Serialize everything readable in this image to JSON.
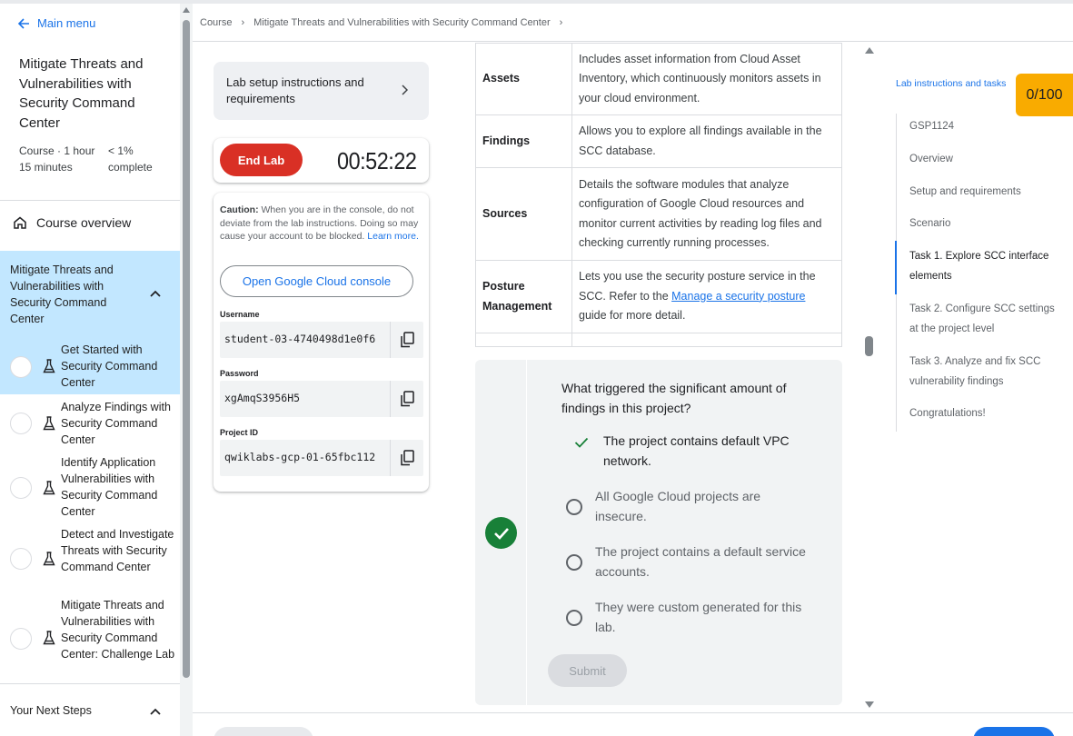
{
  "sidebar": {
    "main_menu": "Main menu",
    "course_title": "Mitigate Threats and Vulnerabilities with Security Command Center",
    "course_meta": "Course · 1 hour 15 minutes",
    "progress": "< 1% complete",
    "course_overview": "Course overview",
    "section_title": "Mitigate Threats and Vulnerabilities with Security Command Center",
    "labs": [
      {
        "label": "Get Started with Security Command Center",
        "active": true
      },
      {
        "label": "Analyze Findings with Security Command Center",
        "active": false
      },
      {
        "label": "Identify Application Vulnerabilities with Security Command Center",
        "active": false
      },
      {
        "label": "Detect and Investigate Threats with Security Command Center",
        "active": false
      },
      {
        "label": "Mitigate Threats and Vulnerabilities with Security Command Center: Challenge Lab",
        "active": false
      }
    ],
    "next_steps": "Your Next Steps"
  },
  "breadcrumb": {
    "course": "Course",
    "title": "Mitigate Threats and Vulnerabilities with Security Command Center"
  },
  "lab_panel": {
    "setup_label": "Lab setup instructions and requirements",
    "end_lab": "End Lab",
    "timer": "00:52:22",
    "caution_bold": "Caution:",
    "caution_text": " When you are in the console, do not deviate from the lab instructions. Doing so may cause your account to be blocked.",
    "learn_more": "Learn more.",
    "open_console": "Open Google Cloud console",
    "username_label": "Username",
    "username": "student-03-4740498d1e0f6",
    "password_label": "Password",
    "password": "xgAmqS3956H5",
    "project_label": "Project ID",
    "project_id": "qwiklabs-gcp-01-65fbc112"
  },
  "feature_table": {
    "rows": [
      {
        "key": "Assets",
        "value": "Includes asset information from Cloud Asset Inventory, which continuously monitors assets in your cloud environment."
      },
      {
        "key": "Findings",
        "value": "Allows you to explore all findings available in the SCC database."
      },
      {
        "key": "Sources",
        "value": "Details the software modules that analyze configuration of Google Cloud resources and monitor current activities by reading log files and checking currently running processes."
      },
      {
        "key": "Posture Management",
        "value_pre": "Lets you use the security posture service in the SCC. Refer to the ",
        "value_link": "Manage a security posture",
        "value_post": " guide for more detail."
      }
    ]
  },
  "quiz": {
    "question": "What triggered the significant amount of findings in this project?",
    "options": [
      {
        "label": "The project contains default VPC network.",
        "correct": true
      },
      {
        "label": "All Google Cloud projects are insecure.",
        "correct": false
      },
      {
        "label": "The project contains a default service accounts.",
        "correct": false
      },
      {
        "label": "They were custom generated for this lab.",
        "correct": false
      }
    ],
    "submit": "Submit"
  },
  "toc": {
    "title": "Lab instructions and tasks",
    "score": "0/100",
    "items": [
      {
        "label": "GSP1124",
        "active": false
      },
      {
        "label": "Overview",
        "active": false
      },
      {
        "label": "Setup and requirements",
        "active": false
      },
      {
        "label": "Scenario",
        "active": false
      },
      {
        "label": "Task 1. Explore SCC interface elements",
        "active": true
      },
      {
        "label": "Task 2. Configure SCC settings at the project level",
        "active": false
      },
      {
        "label": "Task 3. Analyze and fix SCC vulnerability findings",
        "active": false
      },
      {
        "label": "Congratulations!",
        "active": false
      }
    ]
  },
  "colors": {
    "accent": "#1a73e8",
    "selected_bg": "#c2e7ff",
    "end_lab": "#d93025",
    "success": "#188038",
    "score_bg": "#f9ab00"
  }
}
